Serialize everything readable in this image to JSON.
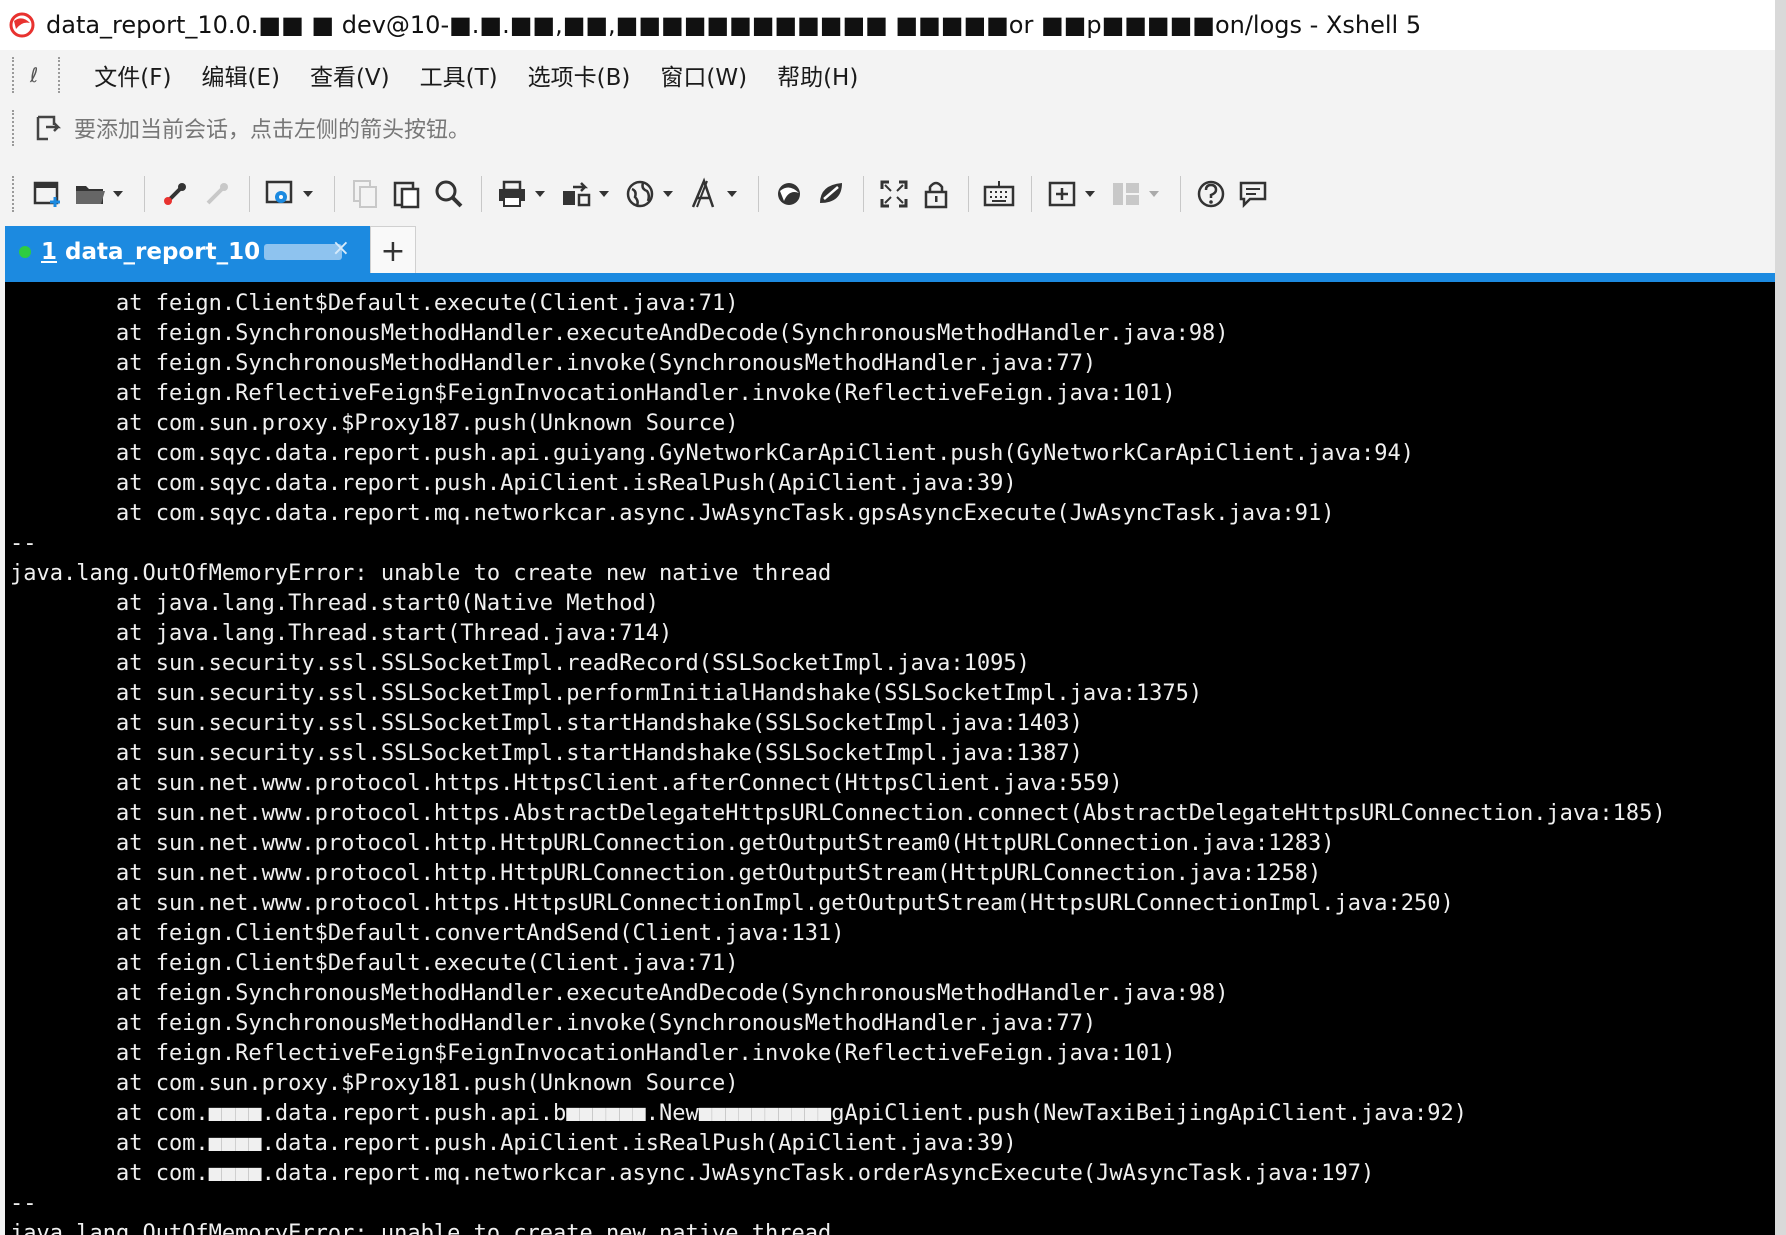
{
  "window": {
    "title": "data_report_10.0.■■ ■ dev@10-■.■.■■,■■,■■■■■■■■■■■■ ■■■■■or ■■p■■■■■on/logs - Xshell 5",
    "app_icon": "xshell-logo"
  },
  "menu": {
    "quick_label": "ℓ",
    "items": [
      "文件(F)",
      "编辑(E)",
      "查看(V)",
      "工具(T)",
      "选项卡(B)",
      "窗口(W)",
      "帮助(H)"
    ]
  },
  "session_bar": {
    "hint": "要添加当前会话，点击左侧的箭头按钮。"
  },
  "toolbar": {
    "icons": [
      "new-session-icon",
      "open-folder-icon",
      "connect-icon",
      "disconnect-icon",
      "properties-icon",
      "copy-icon",
      "paste-icon",
      "find-icon",
      "print-icon",
      "transfer-icon",
      "globe-icon",
      "font-icon",
      "xftp-icon",
      "xagent-icon",
      "fullscreen-icon",
      "lock-icon",
      "keyboard-icon",
      "add-compose-icon",
      "layout-icon",
      "help-icon",
      "feedback-icon"
    ]
  },
  "tabs": {
    "active": {
      "index": "1",
      "label": "data_report_10",
      "close": "×"
    },
    "add_label": "+"
  },
  "colors": {
    "accent": "#1c8ae0",
    "terminal_bg": "#000000",
    "terminal_fg": "#f0f0f0",
    "status_dot": "#2ecc40"
  },
  "terminal": {
    "lines": [
      "        at feign.Client$Default.execute(Client.java:71)",
      "        at feign.SynchronousMethodHandler.executeAndDecode(SynchronousMethodHandler.java:98)",
      "        at feign.SynchronousMethodHandler.invoke(SynchronousMethodHandler.java:77)",
      "        at feign.ReflectiveFeign$FeignInvocationHandler.invoke(ReflectiveFeign.java:101)",
      "        at com.sun.proxy.$Proxy187.push(Unknown Source)",
      "        at com.sqyc.data.report.push.api.guiyang.GyNetworkCarApiClient.push(GyNetworkCarApiClient.java:94)",
      "        at com.sqyc.data.report.push.ApiClient.isRealPush(ApiClient.java:39)",
      "        at com.sqyc.data.report.mq.networkcar.async.JwAsyncTask.gpsAsyncExecute(JwAsyncTask.java:91)",
      "--",
      "java.lang.OutOfMemoryError: unable to create new native thread",
      "        at java.lang.Thread.start0(Native Method)",
      "        at java.lang.Thread.start(Thread.java:714)",
      "        at sun.security.ssl.SSLSocketImpl.readRecord(SSLSocketImpl.java:1095)",
      "        at sun.security.ssl.SSLSocketImpl.performInitialHandshake(SSLSocketImpl.java:1375)",
      "        at sun.security.ssl.SSLSocketImpl.startHandshake(SSLSocketImpl.java:1403)",
      "        at sun.security.ssl.SSLSocketImpl.startHandshake(SSLSocketImpl.java:1387)",
      "        at sun.net.www.protocol.https.HttpsClient.afterConnect(HttpsClient.java:559)",
      "        at sun.net.www.protocol.https.AbstractDelegateHttpsURLConnection.connect(AbstractDelegateHttpsURLConnection.java:185)",
      "        at sun.net.www.protocol.http.HttpURLConnection.getOutputStream0(HttpURLConnection.java:1283)",
      "        at sun.net.www.protocol.http.HttpURLConnection.getOutputStream(HttpURLConnection.java:1258)",
      "        at sun.net.www.protocol.https.HttpsURLConnectionImpl.getOutputStream(HttpsURLConnectionImpl.java:250)",
      "        at feign.Client$Default.convertAndSend(Client.java:131)",
      "        at feign.Client$Default.execute(Client.java:71)",
      "        at feign.SynchronousMethodHandler.executeAndDecode(SynchronousMethodHandler.java:98)",
      "        at feign.SynchronousMethodHandler.invoke(SynchronousMethodHandler.java:77)",
      "        at feign.ReflectiveFeign$FeignInvocationHandler.invoke(ReflectiveFeign.java:101)",
      "        at com.sun.proxy.$Proxy181.push(Unknown Source)",
      "        at com.■■■■.data.report.push.api.b■■■■■■.New■■■■■■■■■■gApiClient.push(NewTaxiBeijingApiClient.java:92)",
      "        at com.■■■■.data.report.push.ApiClient.isRealPush(ApiClient.java:39)",
      "        at com.■■■■.data.report.mq.networkcar.async.JwAsyncTask.orderAsyncExecute(JwAsyncTask.java:197)",
      "--",
      "java.lang.OutOfMemoryError: unable to create new native thread"
    ]
  }
}
